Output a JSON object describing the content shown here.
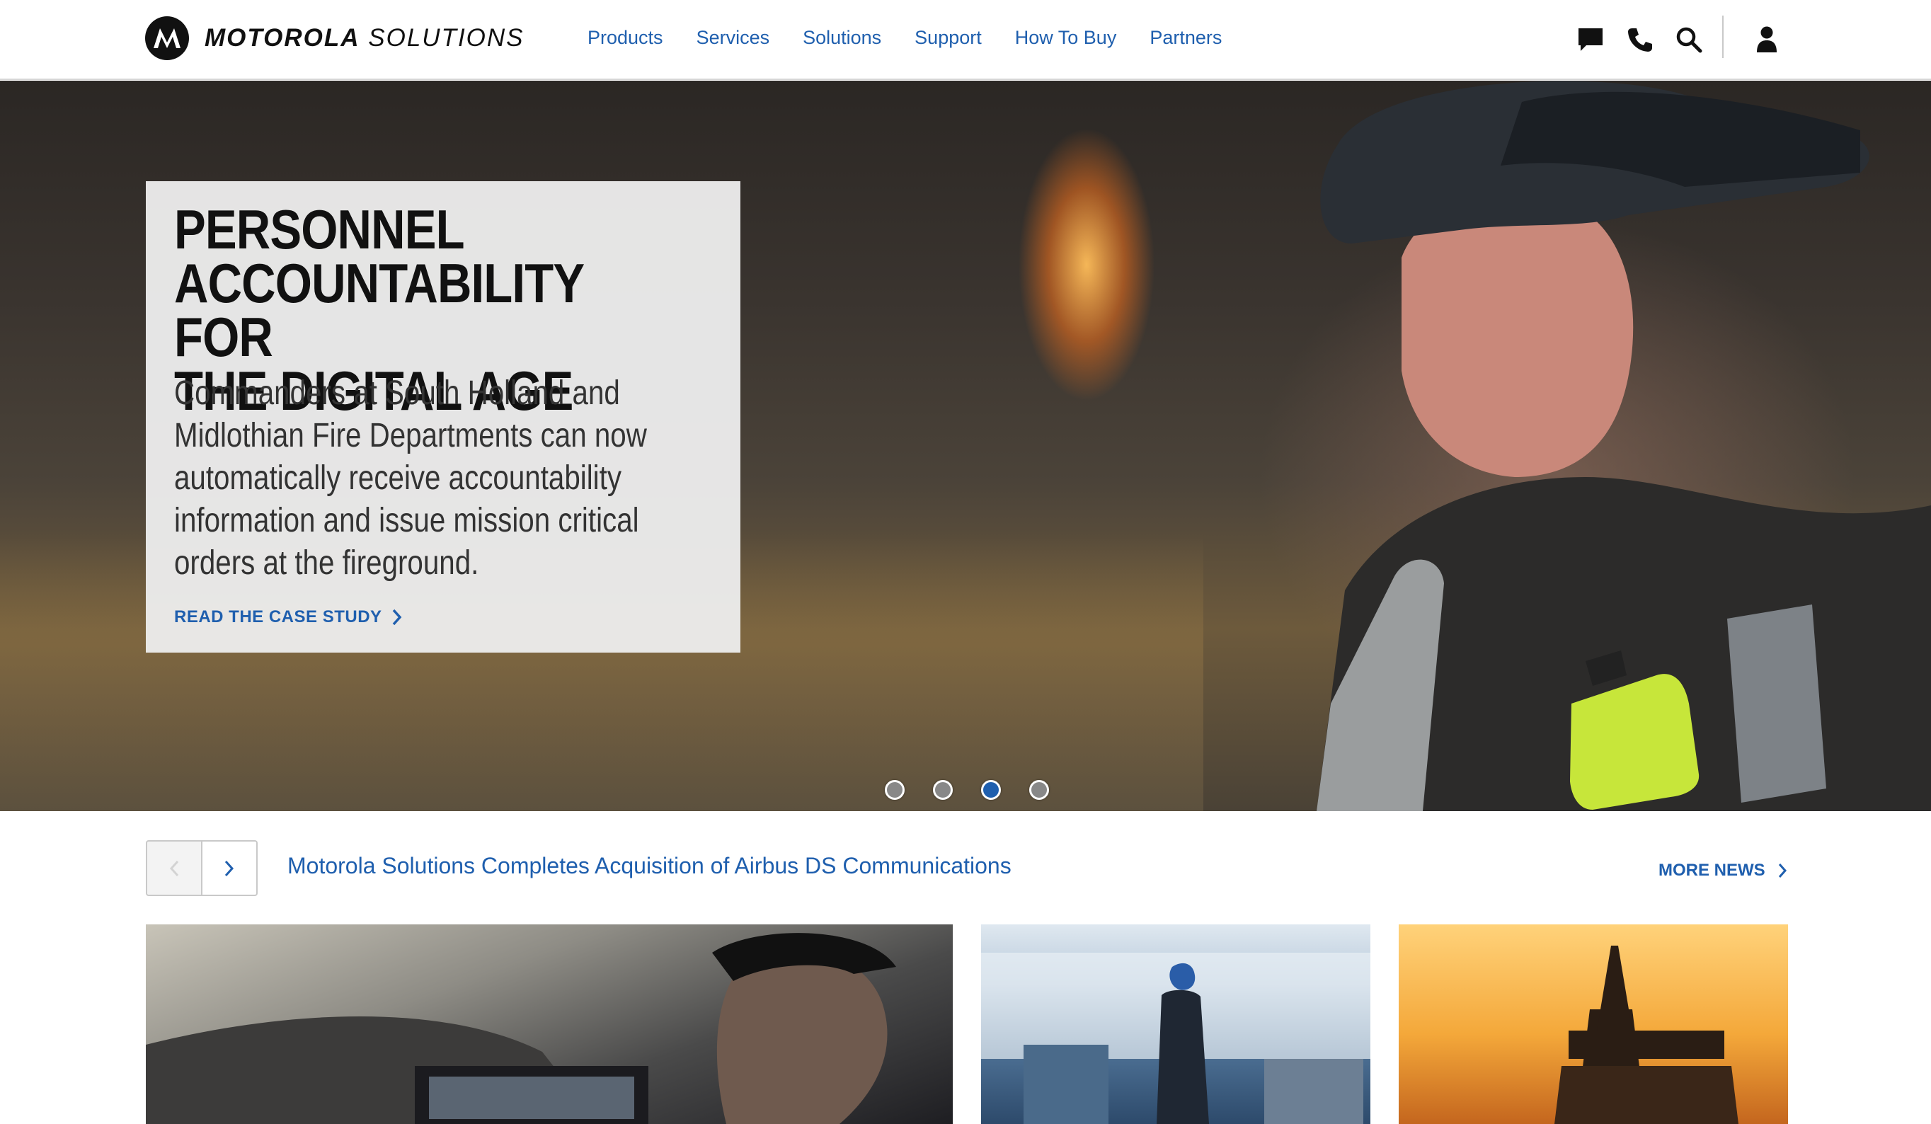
{
  "header": {
    "brand_bold": "MOTOROLA",
    "brand_light": "SOLUTIONS",
    "nav": [
      "Products",
      "Services",
      "Solutions",
      "Support",
      "How To Buy",
      "Partners"
    ],
    "icons": [
      "chat-icon",
      "phone-icon",
      "search-icon",
      "user-icon"
    ]
  },
  "hero": {
    "title": "PERSONNEL\nACCOUNTABILITY FOR\nTHE DIGITAL AGE",
    "body": "Commanders at South Holland and Midlothian Fire Departments can now automatically receive accountability information and issue mission critical orders at the fireground.",
    "cta": "READ THE CASE STUDY",
    "slides_total": 4,
    "active_slide": 3
  },
  "news": {
    "headline": "Motorola Solutions Completes Acquisition of Airbus DS Communications",
    "more_label": "MORE NEWS"
  },
  "colors": {
    "link_blue": "#1f5fae",
    "card_bg": "#ececec"
  }
}
